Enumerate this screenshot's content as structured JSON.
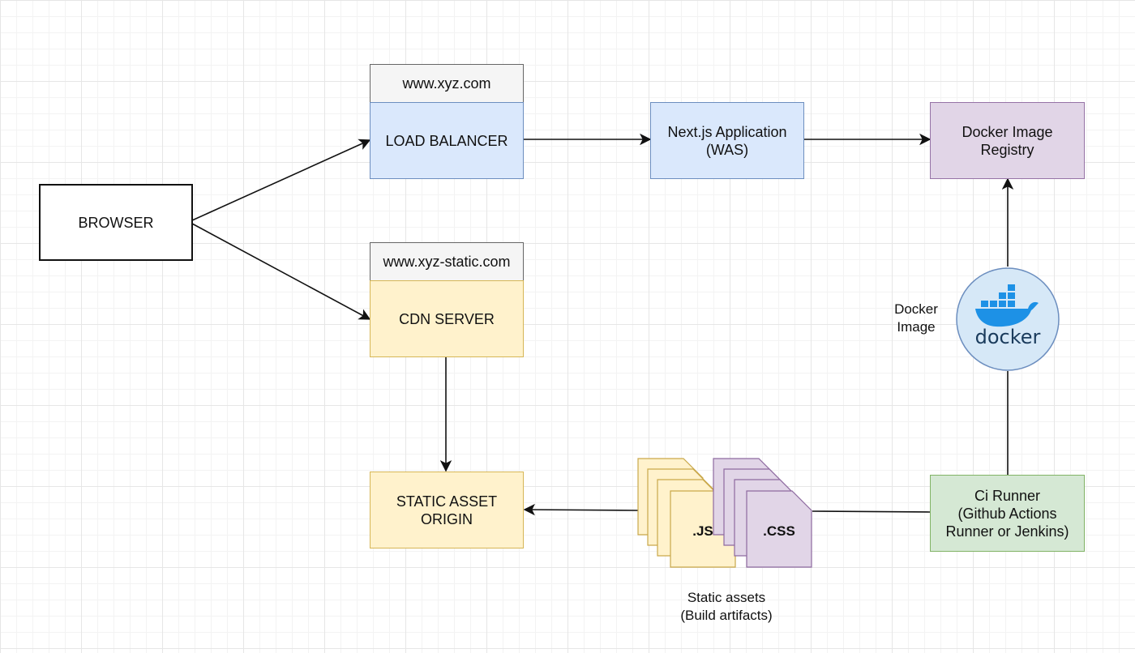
{
  "nodes": {
    "browser": "BROWSER",
    "lb_domain": "www.xyz.com",
    "load_balancer": "LOAD BALANCER",
    "nextjs_app": "Next.js Application\n(WAS)",
    "docker_registry": "Docker Image\nRegistry",
    "cdn_domain": "www.xyz-static.com",
    "cdn_server": "CDN SERVER",
    "static_origin": "STATIC ASSET\nORIGIN",
    "ci_runner": "Ci Runner\n(Github Actions\nRunner or Jenkins)"
  },
  "docker": {
    "logo_text": "docker",
    "side_label": "Docker\nImage"
  },
  "files": {
    "js_label": ".JS",
    "css_label": ".CSS"
  },
  "static_assets_caption": "Static assets\n(Build artifacts)",
  "colors": {
    "blue_fill": "#dae8fc",
    "yellow_fill": "#fff2cc",
    "purple_fill": "#e1d5e7",
    "green_fill": "#d5e8d4",
    "header_fill": "#f5f5f5",
    "docker_blue": "#1d91e6",
    "docker_circle": "#d6e8f7"
  }
}
